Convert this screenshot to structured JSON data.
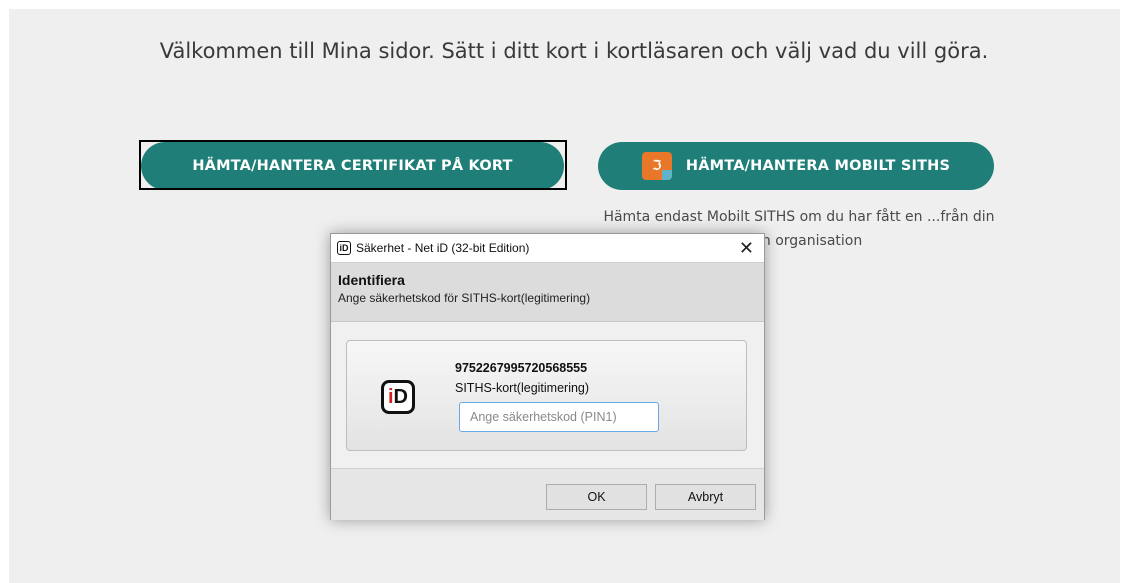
{
  "page": {
    "welcome_text": "Välkommen till Mina sidor. Sätt i ditt kort i kortläsaren och välj vad du vill göra.",
    "certificate_button_label": "HÄMTA/HANTERA CERTIFIKAT PÅ KORT",
    "mobile_button_label": "HÄMTA/HANTERA MOBILT SITHS",
    "mobile_note": "Hämta endast Mobilt SITHS om du har fått en ...från din egen organisation",
    "button_color": "#1f7f78",
    "mobile_icon": "siths-app-icon"
  },
  "dialog": {
    "title": "Säkerhet - Net iD (32-bit Edition)",
    "close_icon": "close-icon",
    "header_title": "Identifiera",
    "header_subtitle": "Ange säkerhetskod för SITHS-kort(legitimering)",
    "card_number": "9752267995720568555",
    "card_type": "SITHS-kort(legitimering)",
    "pin_placeholder": "Ange säkerhetskod (PIN1)",
    "pin_value": "",
    "ok_label": "OK",
    "cancel_label": "Avbryt"
  }
}
